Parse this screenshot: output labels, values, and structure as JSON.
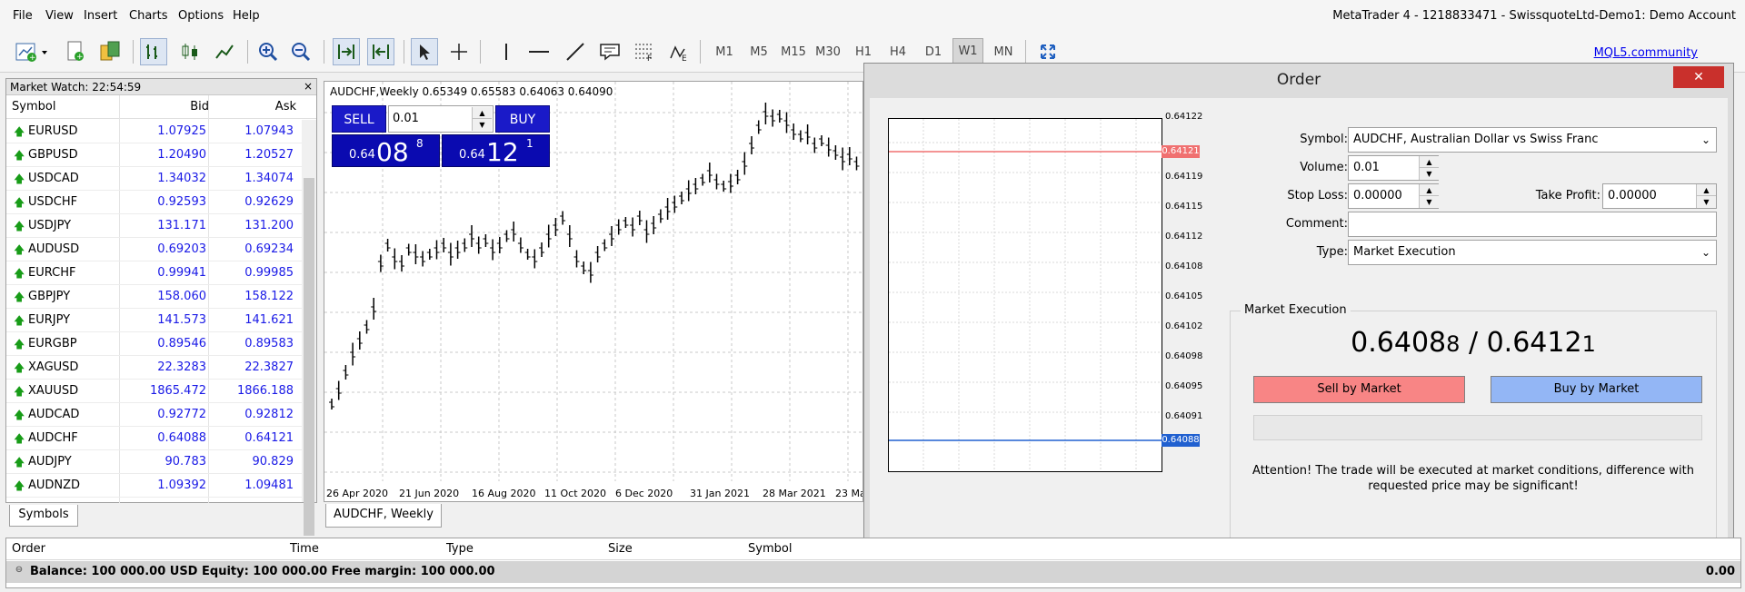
{
  "menu": [
    "File",
    "View",
    "Insert",
    "Charts",
    "Options",
    "Help"
  ],
  "window_title": "MetaTrader 4 - 1218833471 - SwissquoteLtd-Demo1: Demo Account",
  "toolbar": {
    "timeframes": [
      "M1",
      "M5",
      "M15",
      "M30",
      "H1",
      "H4",
      "D1",
      "W1",
      "MN"
    ],
    "active_timeframe": "W1",
    "mql5_link": "MQL5.community"
  },
  "market_watch": {
    "title": "Market Watch: 22:54:59",
    "close": "×",
    "headers": {
      "symbol": "Symbol",
      "bid": "Bid",
      "ask": "Ask"
    },
    "tab": "Symbols",
    "rows": [
      {
        "symbol": "EURUSD",
        "bid": "1.07925",
        "ask": "1.07943"
      },
      {
        "symbol": "GBPUSD",
        "bid": "1.20490",
        "ask": "1.20527"
      },
      {
        "symbol": "USDCAD",
        "bid": "1.34032",
        "ask": "1.34074"
      },
      {
        "symbol": "USDCHF",
        "bid": "0.92593",
        "ask": "0.92629"
      },
      {
        "symbol": "USDJPY",
        "bid": "131.171",
        "ask": "131.200"
      },
      {
        "symbol": "AUDUSD",
        "bid": "0.69203",
        "ask": "0.69234"
      },
      {
        "symbol": "EURCHF",
        "bid": "0.99941",
        "ask": "0.99985"
      },
      {
        "symbol": "GBPJPY",
        "bid": "158.060",
        "ask": "158.122"
      },
      {
        "symbol": "EURJPY",
        "bid": "141.573",
        "ask": "141.621"
      },
      {
        "symbol": "EURGBP",
        "bid": "0.89546",
        "ask": "0.89583"
      },
      {
        "symbol": "XAGUSD",
        "bid": "22.3283",
        "ask": "22.3827"
      },
      {
        "symbol": "XAUUSD",
        "bid": "1865.472",
        "ask": "1866.188"
      },
      {
        "symbol": "AUDCAD",
        "bid": "0.92772",
        "ask": "0.92812"
      },
      {
        "symbol": "AUDCHF",
        "bid": "0.64088",
        "ask": "0.64121"
      },
      {
        "symbol": "AUDJPY",
        "bid": "90.783",
        "ask": "90.829"
      },
      {
        "symbol": "AUDNZD",
        "bid": "1.09392",
        "ask": "1.09481"
      }
    ]
  },
  "chart": {
    "label": "AUDCHF,Weekly  0.65349 0.65583 0.64063 0.64090",
    "tab": "AUDCHF, Weekly",
    "one_click": {
      "sell": "SELL",
      "buy": "BUY",
      "lot": "0.01",
      "sell_pre": "0.64",
      "sell_big": "08",
      "sell_sup": "8",
      "buy_pre": "0.64",
      "buy_big": "12",
      "buy_sup": "1"
    },
    "x_labels": [
      "26 Apr 2020",
      "21 Jun 2020",
      "16 Aug 2020",
      "11 Oct 2020",
      "6 Dec 2020",
      "31 Jan 2021",
      "28 Mar 2021",
      "23 Ma"
    ]
  },
  "chart_data": {
    "type": "ohlc",
    "series": "AUDCHF Weekly",
    "ohlc_current": {
      "open": 0.65349,
      "high": 0.65583,
      "low": 0.64063,
      "close": 0.6409
    }
  },
  "order": {
    "title": "Order",
    "close": "✕",
    "symbol_label": "Symbol:",
    "symbol_value": "AUDCHF, Australian Dollar vs Swiss Franc",
    "volume_label": "Volume:",
    "volume_value": "0.01",
    "sl_label": "Stop Loss:",
    "sl_value": "0.00000",
    "tp_label": "Take Profit:",
    "tp_value": "0.00000",
    "comment_label": "Comment:",
    "comment_value": "",
    "type_label": "Type:",
    "type_value": "Market Execution",
    "section": "Market Execution",
    "quote_bid_main": "0.6408",
    "quote_bid_last": "8",
    "quote_sep": " / ",
    "quote_ask_main": "0.6412",
    "quote_ask_last": "1",
    "sell_btn": "Sell by Market",
    "buy_btn": "Buy by Market",
    "attention": "Attention! The trade will be executed at market conditions, difference with requested price may be significant!",
    "tick_prices": [
      "0.64122",
      "0.64119",
      "0.64115",
      "0.64112",
      "0.64108",
      "0.64105",
      "0.64102",
      "0.64098",
      "0.64095",
      "0.64091"
    ],
    "ask_tag": "0.64121",
    "bid_tag": "0.64088",
    "colors": {
      "ask_line": "#f07070",
      "bid_line": "#2060d0"
    }
  },
  "terminal": {
    "headers": [
      "Order",
      "Time",
      "Type",
      "Size",
      "Symbol"
    ],
    "balance_line": "Balance: 100 000.00 USD  Equity: 100 000.00  Free margin: 100 000.00",
    "profit": "0.00"
  }
}
